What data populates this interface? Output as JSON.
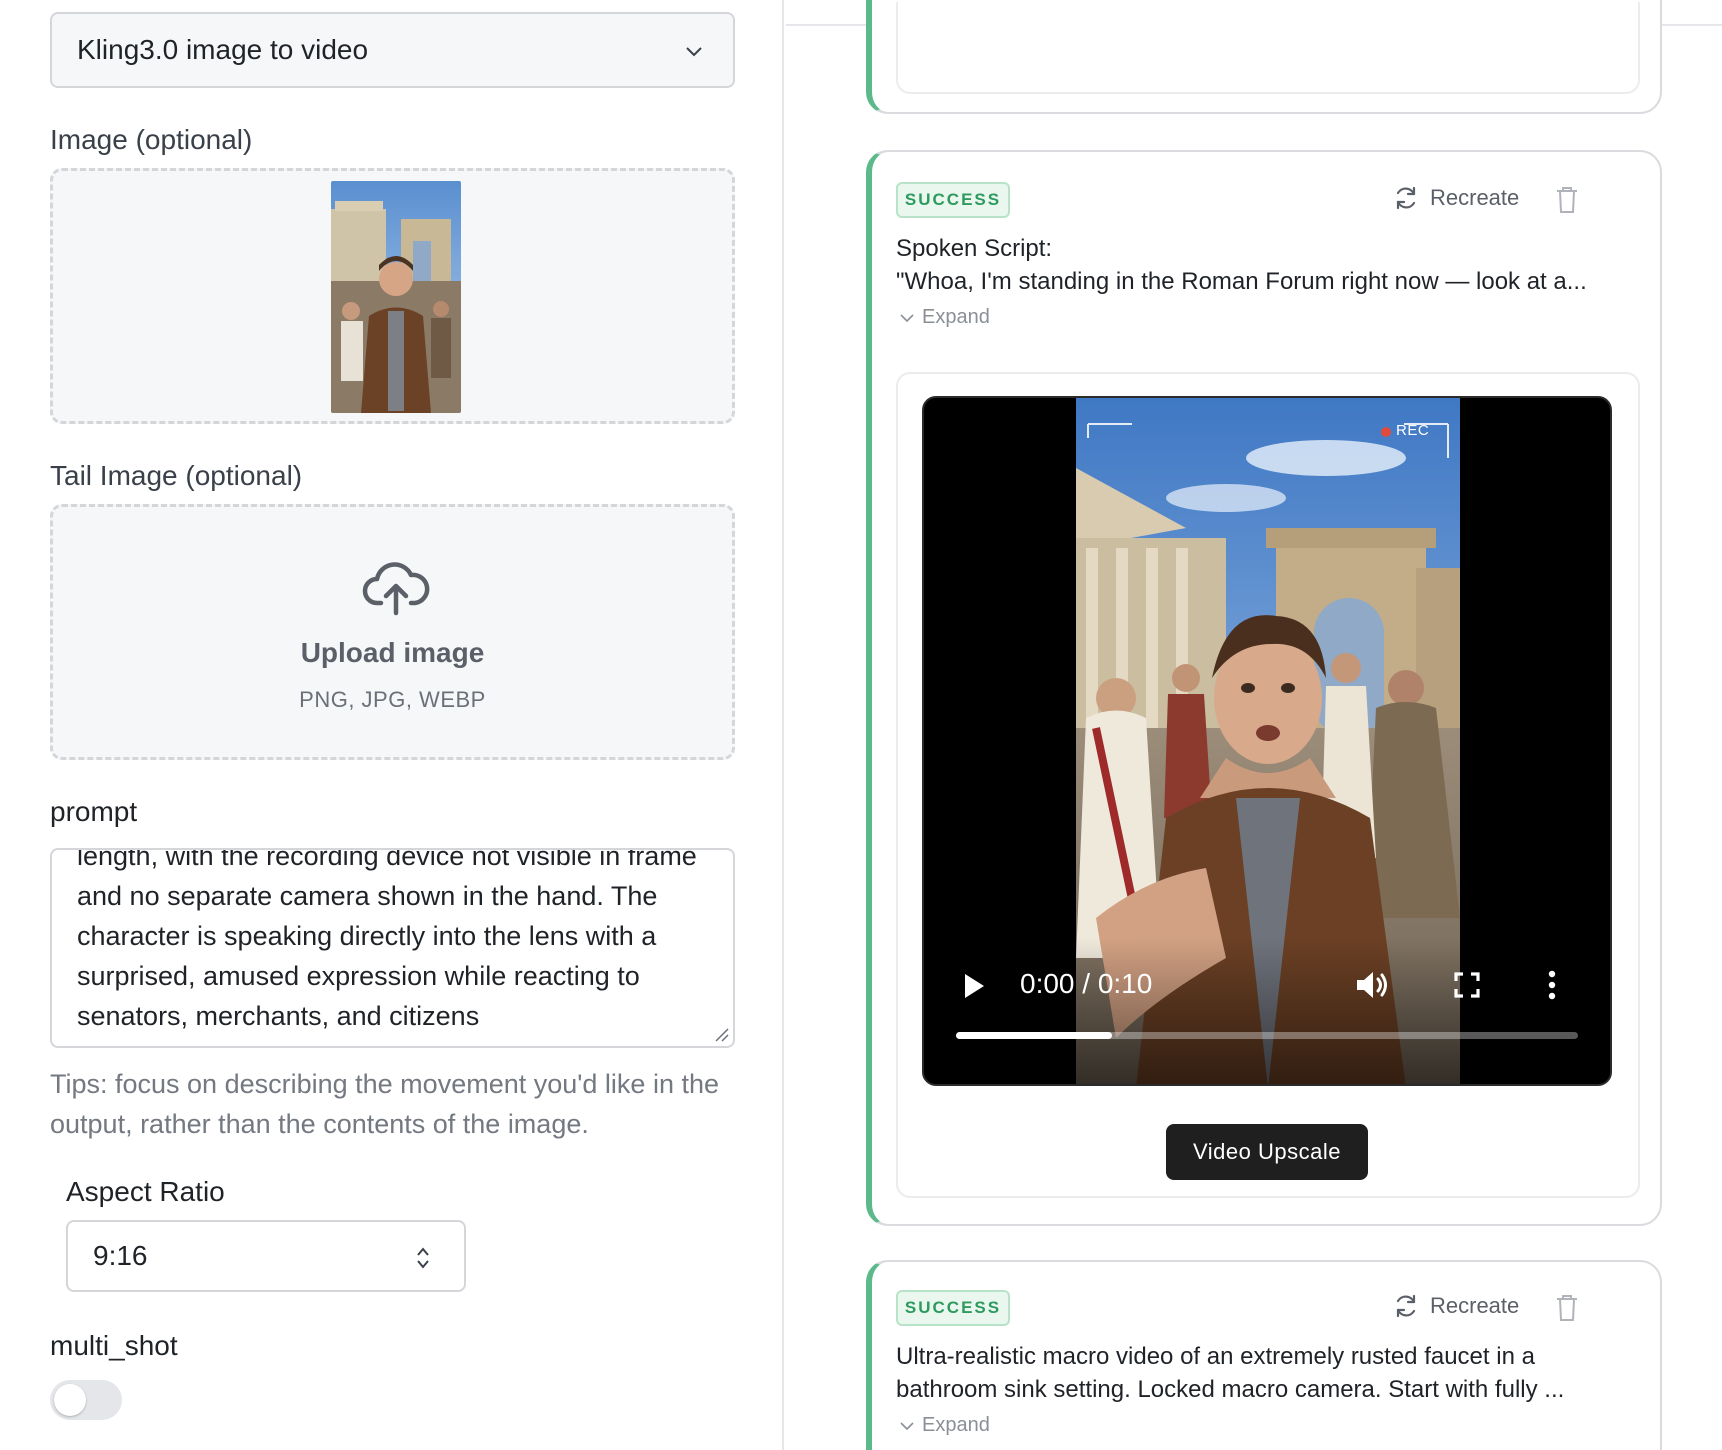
{
  "left_panel": {
    "model_select": {
      "value": "Kling3.0 image to video"
    },
    "image_field": {
      "label": "Image (optional)"
    },
    "tail_image_field": {
      "label": "Tail Image (optional)",
      "upload_title": "Upload image",
      "upload_formats": "PNG, JPG, WEBP"
    },
    "prompt": {
      "label": "prompt",
      "value": "length, with the recording device not visible in frame and no separate camera shown in the hand. The character is speaking directly into the lens with a surprised, amused expression while reacting to senators, merchants, and citizens"
    },
    "tips": "Tips: focus on describing the movement you'd like in the output, rather than the contents of the image.",
    "aspect_ratio": {
      "label": "Aspect Ratio",
      "value": "9:16"
    },
    "multi_shot": {
      "label": "multi_shot",
      "enabled": false
    }
  },
  "right_panel": {
    "cards": [
      {
        "status": "SUCCESS",
        "recreate_label": "Recreate",
        "script_heading": "Spoken Script:",
        "script_preview": "\"Whoa, I'm standing in the Roman Forum right now — look at a...",
        "expand_label": "Expand",
        "video": {
          "rec_label": "REC",
          "time": "0:00 / 0:10",
          "progress": 0.25
        },
        "upscale_label": "Video Upscale"
      },
      {
        "status": "SUCCESS",
        "recreate_label": "Recreate",
        "description_line1": "Ultra-realistic macro video of an extremely rusted faucet in a",
        "description_line2": "bathroom sink setting. Locked macro camera. Start with fully ...",
        "expand_label": "Expand"
      }
    ]
  },
  "colors": {
    "success_green": "#2e9a5e",
    "card_accent": "#5bb98a",
    "upscale_button": "#1f1f1f"
  }
}
